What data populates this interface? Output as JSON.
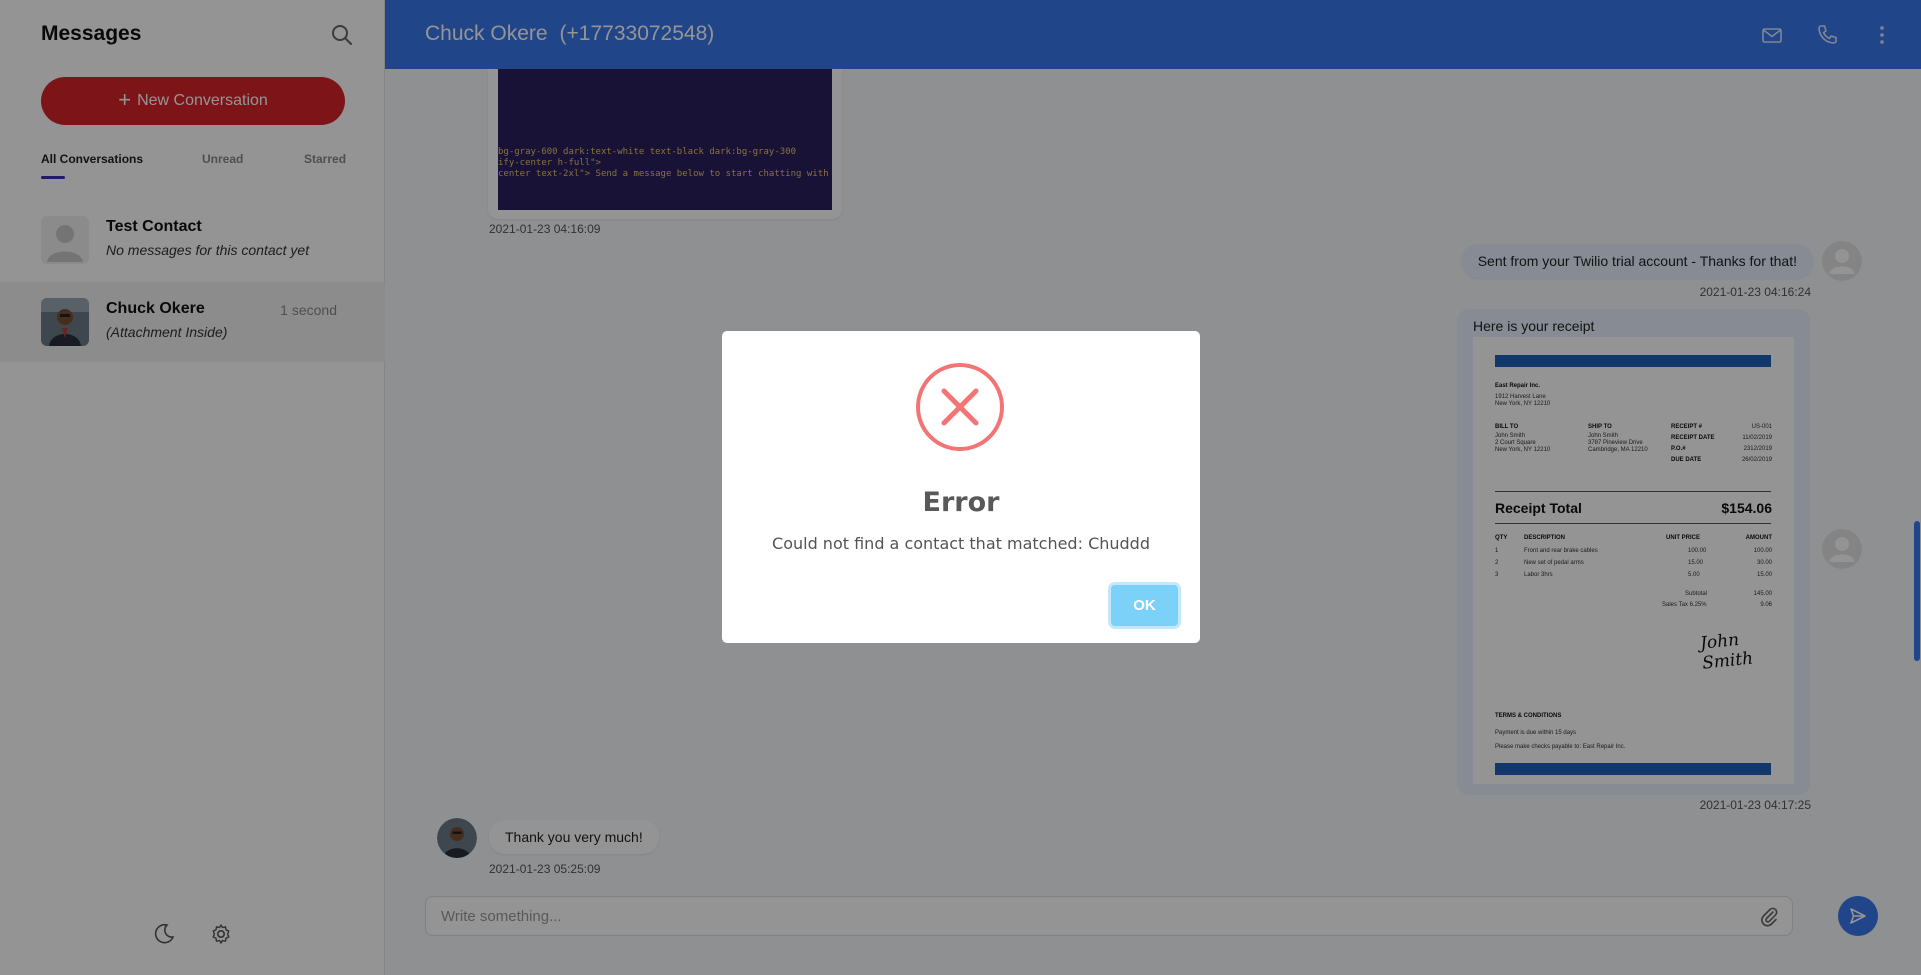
{
  "sidebar": {
    "title": "Messages",
    "search_icon": "search-icon",
    "new_conversation_label": "New Conversation",
    "tabs": [
      {
        "label": "All Conversations",
        "active": true
      },
      {
        "label": "Unread",
        "active": false
      },
      {
        "label": "Starred",
        "active": false
      }
    ],
    "conversations": [
      {
        "name": "Test Contact",
        "preview": "No messages for this contact yet",
        "time": "",
        "avatar": "default-avatar",
        "selected": false
      },
      {
        "name": "Chuck Okere",
        "preview": "(Attachment Inside)",
        "time": "1 second",
        "avatar": "photo-avatar",
        "selected": true
      }
    ],
    "footer_icons": [
      "moon-icon",
      "gear-icon"
    ]
  },
  "header": {
    "contact_name": "Chuck Okere",
    "contact_phone": "(+17733072548)",
    "icons": [
      "mail-icon",
      "phone-icon",
      "more-vertical-icon"
    ]
  },
  "chat": {
    "messages": [
      {
        "direction": "in",
        "type": "image",
        "image_text": [
          "bg-gray-600  dark:text-white  text-black  dark:bg-gray-300",
          "ify-center h-full\">",
          "center text-2xl\">  Send a message below to start chatting with"
        ],
        "timestamp": "2021-01-23 04:16:09"
      },
      {
        "direction": "out",
        "type": "text",
        "text": "Sent from your Twilio trial account - Thanks for that!",
        "timestamp": "2021-01-23 04:16:24"
      },
      {
        "direction": "out",
        "type": "attachment",
        "text": "Here is your receipt",
        "timestamp": "2021-01-23 04:17:25"
      },
      {
        "direction": "in",
        "type": "text",
        "text": "Thank you very much!",
        "timestamp": "2021-01-23 05:25:09"
      }
    ],
    "receipt": {
      "company": "East Repair Inc.",
      "company_addr1": "1912 Harvest Lane",
      "company_addr2": "New York, NY 12210",
      "bill_to_label": "BILL TO",
      "bill_to": [
        "John Smith",
        "2 Court Square",
        "New York, NY 12210"
      ],
      "ship_to_label": "SHIP TO",
      "ship_to": [
        "John Smith",
        "3787 Pineview Drive",
        "Cambridge, MA 12210"
      ],
      "meta_labels": [
        "RECEIPT #",
        "RECEIPT DATE",
        "P.O.#",
        "DUE DATE"
      ],
      "meta_values": [
        "US-001",
        "11/02/2019",
        "2312/2019",
        "26/02/2019"
      ],
      "total_label": "Receipt Total",
      "total_value": "$154.06",
      "col_qty": "QTY",
      "col_desc": "DESCRIPTION",
      "col_price": "UNIT PRICE",
      "col_amount": "AMOUNT",
      "items": [
        {
          "qty": "1",
          "desc": "Front and rear brake cables",
          "price": "100.00",
          "amount": "100.00"
        },
        {
          "qty": "2",
          "desc": "New set of pedal arms",
          "price": "15.00",
          "amount": "30.00"
        },
        {
          "qty": "3",
          "desc": "Labor 3hrs",
          "price": "5.00",
          "amount": "15.00"
        }
      ],
      "subtotal_label": "Subtotal",
      "subtotal_value": "145.00",
      "tax_label": "Sales Tax 6.25%",
      "tax_value": "9.06",
      "signature": "John Smith",
      "terms_title": "TERMS & CONDITIONS",
      "terms_line1": "Payment is due within 15 days",
      "terms_line2": "Please make checks payable to: East Repair Inc."
    },
    "input_placeholder": "Write something...",
    "attach_icon": "paperclip-icon",
    "send_icon": "send-icon"
  },
  "modal": {
    "icon": "error-x-icon",
    "title": "Error",
    "text": "Could not find a contact that matched: Chuddd",
    "ok_label": "OK"
  },
  "colors": {
    "header_blue": "#3a77ec",
    "new_conversation_red": "#d8232a",
    "ok_button": "#7cd1f9",
    "error_red": "#f27474",
    "receipt_blue": "#1f5fb8"
  }
}
